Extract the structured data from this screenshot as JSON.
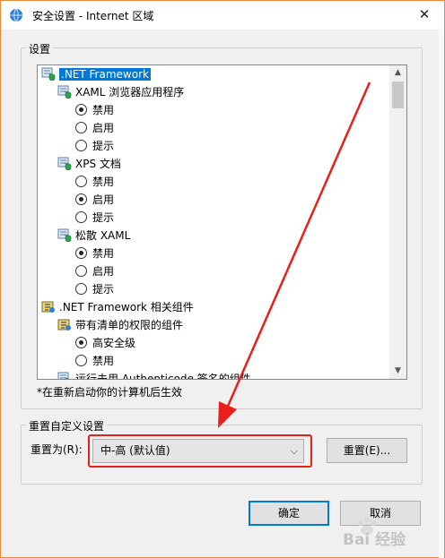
{
  "window": {
    "title": "安全设置 - Internet 区域",
    "close_symbol": "✕"
  },
  "settings_group": {
    "label": "设置",
    "tree": [
      {
        "kind": "category",
        "label": ".NET Framework",
        "icon": "settings-shield-icon",
        "selected": true
      },
      {
        "kind": "group",
        "label": "XAML 浏览器应用程序",
        "icon": "settings-shield-icon"
      },
      {
        "kind": "option",
        "label": "禁用",
        "checked": true
      },
      {
        "kind": "option",
        "label": "启用",
        "checked": false
      },
      {
        "kind": "option",
        "label": "提示",
        "checked": false
      },
      {
        "kind": "group",
        "label": "XPS 文档",
        "icon": "settings-shield-icon"
      },
      {
        "kind": "option",
        "label": "禁用",
        "checked": false
      },
      {
        "kind": "option",
        "label": "启用",
        "checked": true
      },
      {
        "kind": "option",
        "label": "提示",
        "checked": false
      },
      {
        "kind": "group",
        "label": "松散 XAML",
        "icon": "settings-shield-icon"
      },
      {
        "kind": "option",
        "label": "禁用",
        "checked": true
      },
      {
        "kind": "option",
        "label": "启用",
        "checked": false
      },
      {
        "kind": "option",
        "label": "提示",
        "checked": false
      },
      {
        "kind": "category",
        "label": ".NET Framework 相关组件",
        "icon": "component-icon",
        "selected": false
      },
      {
        "kind": "group",
        "label": "带有清单的权限的组件",
        "icon": "component-icon"
      },
      {
        "kind": "option",
        "label": "高安全级",
        "checked": true
      },
      {
        "kind": "option",
        "label": "禁用",
        "checked": false
      },
      {
        "kind": "group",
        "label": "运行未用 Authenticode 签名的组件",
        "icon": "settings-shield-icon"
      }
    ],
    "note": "*在重新启动你的计算机后生效"
  },
  "reset_group": {
    "label": "重置自定义设置",
    "reset_to_label": "重置为(R):",
    "selected_level": "中-高 (默认值)",
    "reset_button": "重置(E)..."
  },
  "footer": {
    "ok_button": "确定",
    "cancel_button": "取消"
  },
  "watermark": {
    "text": "Bai 经验"
  },
  "colors": {
    "annotation_red": "#e8201c",
    "selection_blue": "#0078d7",
    "window_border": "#e88a3c"
  }
}
